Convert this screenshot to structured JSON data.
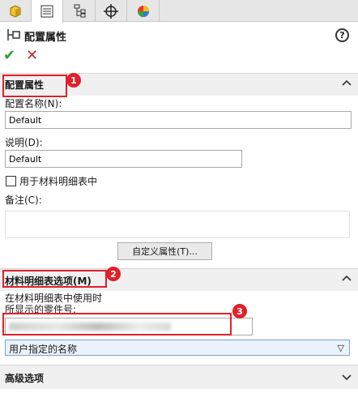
{
  "header": {
    "title": "配置属性",
    "help": "?"
  },
  "actions": {
    "ok": "✔",
    "cancel": "✕"
  },
  "config_group": {
    "title": "配置属性",
    "name_label": "配置名称(N):",
    "name_value": "Default",
    "desc_label": "说明(D):",
    "desc_value": "Default",
    "bom_checkbox_label": "用于材料明细表中",
    "notes_label": "备注(C):",
    "custom_props_button": "自定义属性(T)..."
  },
  "bom_group": {
    "title": "材料明细表选项(M)",
    "desc_line1": "在材料明细表中使用时",
    "desc_line2": "所显示的零件号:",
    "select_value": "用户指定的名称"
  },
  "advanced_group": {
    "title": "高级选项"
  },
  "callouts": [
    "1",
    "2",
    "3"
  ],
  "colors": {
    "accent_red": "#e0202a",
    "ok_green": "#2f9e2f"
  }
}
